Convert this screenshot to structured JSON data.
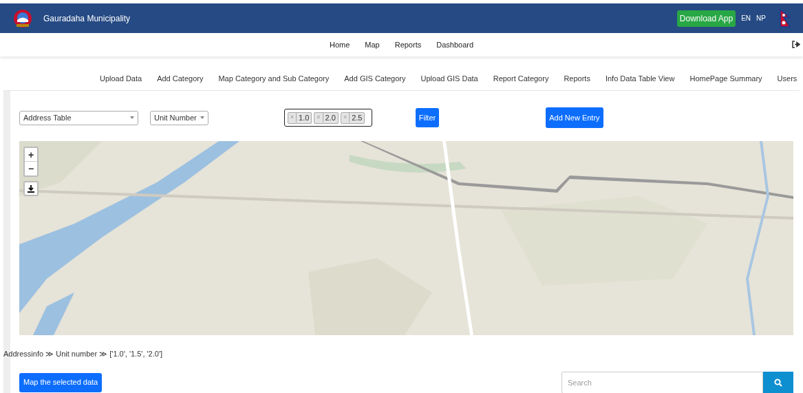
{
  "header": {
    "title": "Gauradaha Municipality",
    "download_button": "Download App",
    "languages": [
      {
        "label": "EN"
      },
      {
        "label": "NP"
      }
    ]
  },
  "main_nav": [
    {
      "label": "Home"
    },
    {
      "label": "Map"
    },
    {
      "label": "Reports"
    },
    {
      "label": "Dashboard"
    }
  ],
  "admin_nav": [
    {
      "label": "Upload Data"
    },
    {
      "label": "Add Category"
    },
    {
      "label": "Map Category and Sub Category"
    },
    {
      "label": "Add GIS Category"
    },
    {
      "label": "Upload GIS Data"
    },
    {
      "label": "Report Category"
    },
    {
      "label": "Reports"
    },
    {
      "label": "Info Data Table View"
    },
    {
      "label": "HomePage Summary"
    },
    {
      "label": "Users"
    }
  ],
  "filters": {
    "table_select": "Address Table",
    "field_select": "Unit Number",
    "selected_values": [
      {
        "remove": "×",
        "value": "1.0"
      },
      {
        "remove": "×",
        "value": "2.0"
      },
      {
        "remove": "×",
        "value": "2.5"
      }
    ],
    "filter_button": "Filter",
    "add_button": "Add New Entry"
  },
  "map": {
    "zoom_in": "+",
    "zoom_out": "−"
  },
  "breadcrumb": "Addressinfo ≫ Unit number ≫ ['1.0', '1.5', '2.0']",
  "map_selected_button": "Map the selected data",
  "search": {
    "placeholder": "Search"
  }
}
